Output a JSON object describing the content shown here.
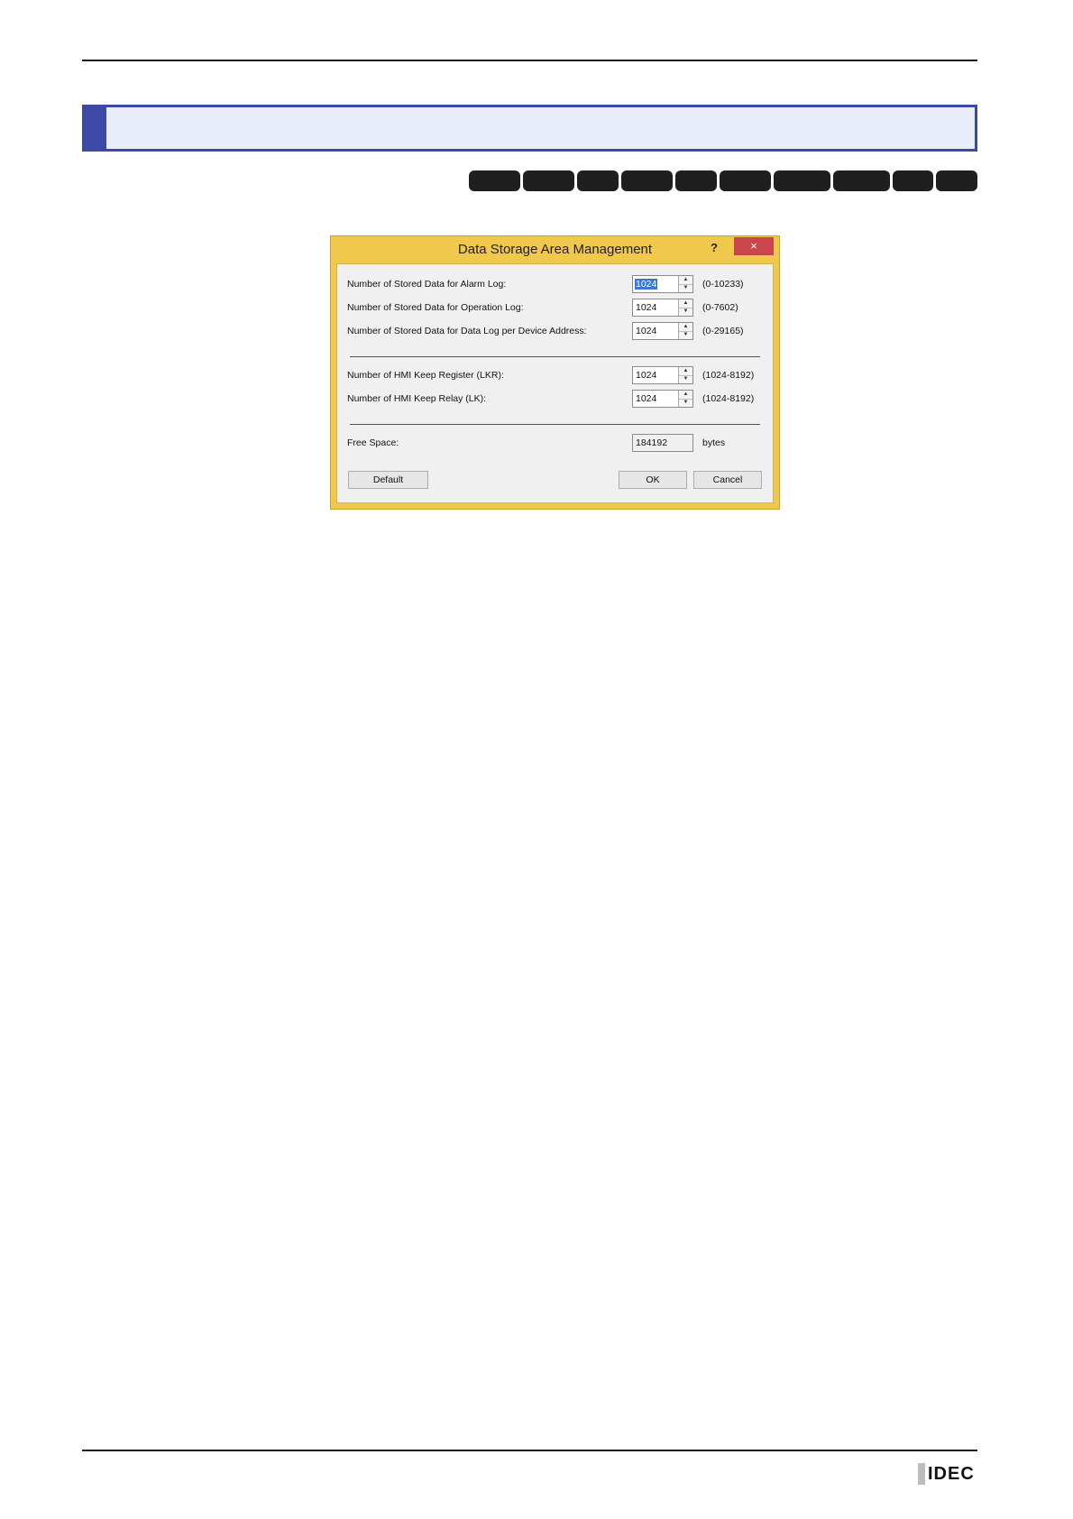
{
  "dialog": {
    "title": "Data Storage Area Management",
    "help_label": "?",
    "close_label": "×",
    "rows": [
      {
        "label": "Number of Stored Data for Alarm Log:",
        "value": "1024",
        "range": "(0-10233)"
      },
      {
        "label": "Number of Stored Data for Operation Log:",
        "value": "1024",
        "range": "(0-7602)"
      },
      {
        "label": "Number of Stored Data for Data Log per Device Address:",
        "value": "1024",
        "range": "(0-29165)"
      },
      {
        "label": "Number of HMI Keep Register (LKR):",
        "value": "1024",
        "range": "(1024-8192)"
      },
      {
        "label": "Number of HMI Keep Relay (LK):",
        "value": "1024",
        "range": "(1024-8192)"
      }
    ],
    "free_space": {
      "label": "Free Space:",
      "value": "184192",
      "unit": "bytes"
    },
    "buttons": {
      "default": "Default",
      "ok": "OK",
      "cancel": "Cancel"
    }
  },
  "logo": {
    "text": "IDEC"
  },
  "colors": {
    "accent": "#3c4aa6",
    "dialog_frame": "#f0c84b",
    "close": "#c9474b"
  }
}
